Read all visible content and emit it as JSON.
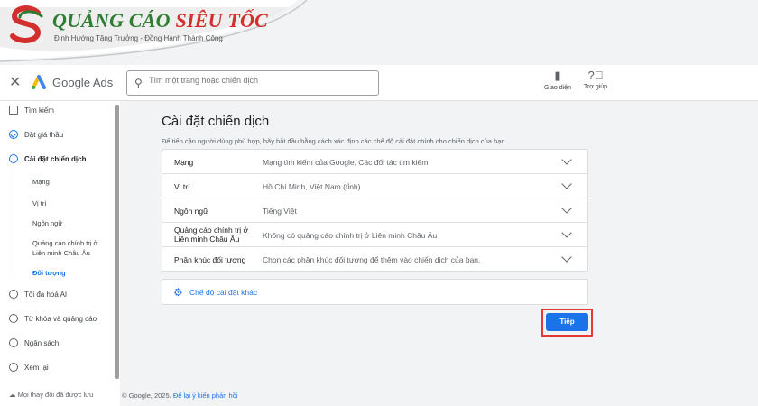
{
  "brand": {
    "name_part1": "QUẢNG CÁO",
    "name_part2": "SIÊU TỐC",
    "tagline": "Định Hướng Tăng Trưởng - Đồng Hành Thành Công"
  },
  "header": {
    "app_title": "Google Ads",
    "search_placeholder": "Tìm một trang hoặc chiến dịch",
    "view_label": "Giao diện",
    "help_label": "Trợ giúp"
  },
  "sidebar": {
    "items": [
      {
        "label": "Tìm kiếm",
        "icon": "search-box-icon"
      },
      {
        "label": "Đặt giá thầu",
        "icon": "check-circle-icon"
      },
      {
        "label": "Cài đặt chiến dịch",
        "icon": "active-circle-icon"
      }
    ],
    "subitems": [
      {
        "label": "Mạng"
      },
      {
        "label": "Vị trí"
      },
      {
        "label": "Ngôn ngữ"
      },
      {
        "label": "Quảng cáo chính trị ở Liên minh Châu Âu"
      },
      {
        "label": "Đối tượng"
      }
    ],
    "more_items": [
      {
        "label": "Tối đa hoá AI"
      },
      {
        "label": "Từ khóa và quảng cáo"
      },
      {
        "label": "Ngân sách"
      },
      {
        "label": "Xem lại"
      }
    ],
    "footer": "Mọi thay đổi đã được lưu"
  },
  "main": {
    "title": "Cài đặt chiến dịch",
    "subtitle": "Để tiếp cận người dùng phù hợp, hãy bắt đầu bằng cách xác định các chế độ cài đặt chính cho chiến dịch của bạn",
    "settings": [
      {
        "label": "Mạng",
        "value": "Mạng tìm kiếm của Google, Các đối tác tìm kiếm"
      },
      {
        "label": "Vị trí",
        "value": "Hồ Chí Minh, Việt Nam (tỉnh)"
      },
      {
        "label": "Ngôn ngữ",
        "value": "Tiếng Việt"
      },
      {
        "label": "Quảng cáo chính trị ở Liên minh Châu Âu",
        "value": "Không có quảng cáo chính trị ở Liên minh Châu Âu"
      },
      {
        "label": "Phân khúc đối tượng",
        "value": "Chọn các phân khúc đối tượng để thêm vào chiến dịch của bạn."
      }
    ],
    "other_settings": "Chế độ cài đặt khác",
    "next_button": "Tiếp"
  },
  "footer": {
    "copyright": "© Google, 2025.",
    "feedback": "Để lại ý kiến phản hồi"
  },
  "colors": {
    "accent": "#1a73e8",
    "highlight": "#e53935",
    "brand_green": "#2e7d32",
    "brand_red": "#d32f2f"
  }
}
